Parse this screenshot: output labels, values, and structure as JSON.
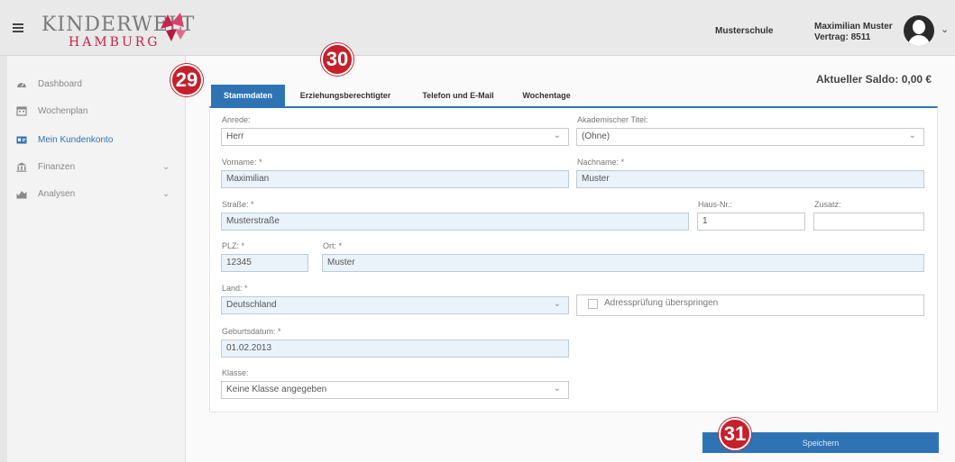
{
  "header": {
    "logo_top": "KINDERWELT",
    "logo_bottom": "HAMBURG",
    "school": "Musterschule",
    "user_name": "Maximilian Muster",
    "user_contract": "Vertrag: 8511",
    "hamburger_icon": "hamburger-menu-icon",
    "avatar_icon": "user-avatar-icon"
  },
  "sidebar": {
    "items": [
      {
        "label": "Dashboard",
        "icon": "dashboard-icon",
        "active": false,
        "expandable": false
      },
      {
        "label": "Wochenplan",
        "icon": "calendar-icon",
        "active": false,
        "expandable": false
      },
      {
        "label": "Mein Kundenkonto",
        "icon": "id-card-icon",
        "active": true,
        "expandable": false
      },
      {
        "label": "Finanzen",
        "icon": "bank-icon",
        "active": false,
        "expandable": true
      },
      {
        "label": "Analysen",
        "icon": "chart-icon",
        "active": false,
        "expandable": true
      }
    ]
  },
  "main": {
    "saldo": "Aktueller Saldo: 0,00 €",
    "tabs": [
      {
        "label": "Stammdaten",
        "active": true
      },
      {
        "label": "Erziehungsberechtigter",
        "active": false
      },
      {
        "label": "Telefon und E-Mail",
        "active": false
      },
      {
        "label": "Wochentage",
        "active": false
      }
    ],
    "form": {
      "anrede": {
        "label": "Anrede:",
        "value": "Herr"
      },
      "titel": {
        "label": "Akademischer Titel:",
        "value": "(Ohne)"
      },
      "vorname": {
        "label": "Vorname: *",
        "value": "Maximilian"
      },
      "nachname": {
        "label": "Nachname: *",
        "value": "Muster"
      },
      "strasse": {
        "label": "Straße: *",
        "value": "Musterstraße"
      },
      "hausnr": {
        "label": "Haus-Nr.:",
        "value": "1"
      },
      "zusatz": {
        "label": "Zusatz:",
        "value": ""
      },
      "plz": {
        "label": "PLZ: *",
        "value": "12345"
      },
      "ort": {
        "label": "Ort: *",
        "value": "Muster"
      },
      "land": {
        "label": "Land: *",
        "value": "Deutschland"
      },
      "adresspruefung": {
        "label": "Adressprüfung überspringen",
        "checked": false
      },
      "geburtsdatum": {
        "label": "Geburtsdatum: *",
        "value": "01.02.2013"
      },
      "klasse": {
        "label": "Klasse:",
        "value": "Keine Klasse angegeben"
      }
    },
    "save_label": "Speichern"
  },
  "badges": {
    "b29": "29",
    "b30": "30",
    "b31": "31"
  },
  "colors": {
    "accent": "#2e74b5",
    "badge": "#c5202b",
    "field_filled": "#eaf2fa",
    "logo_red": "#c8234a"
  }
}
